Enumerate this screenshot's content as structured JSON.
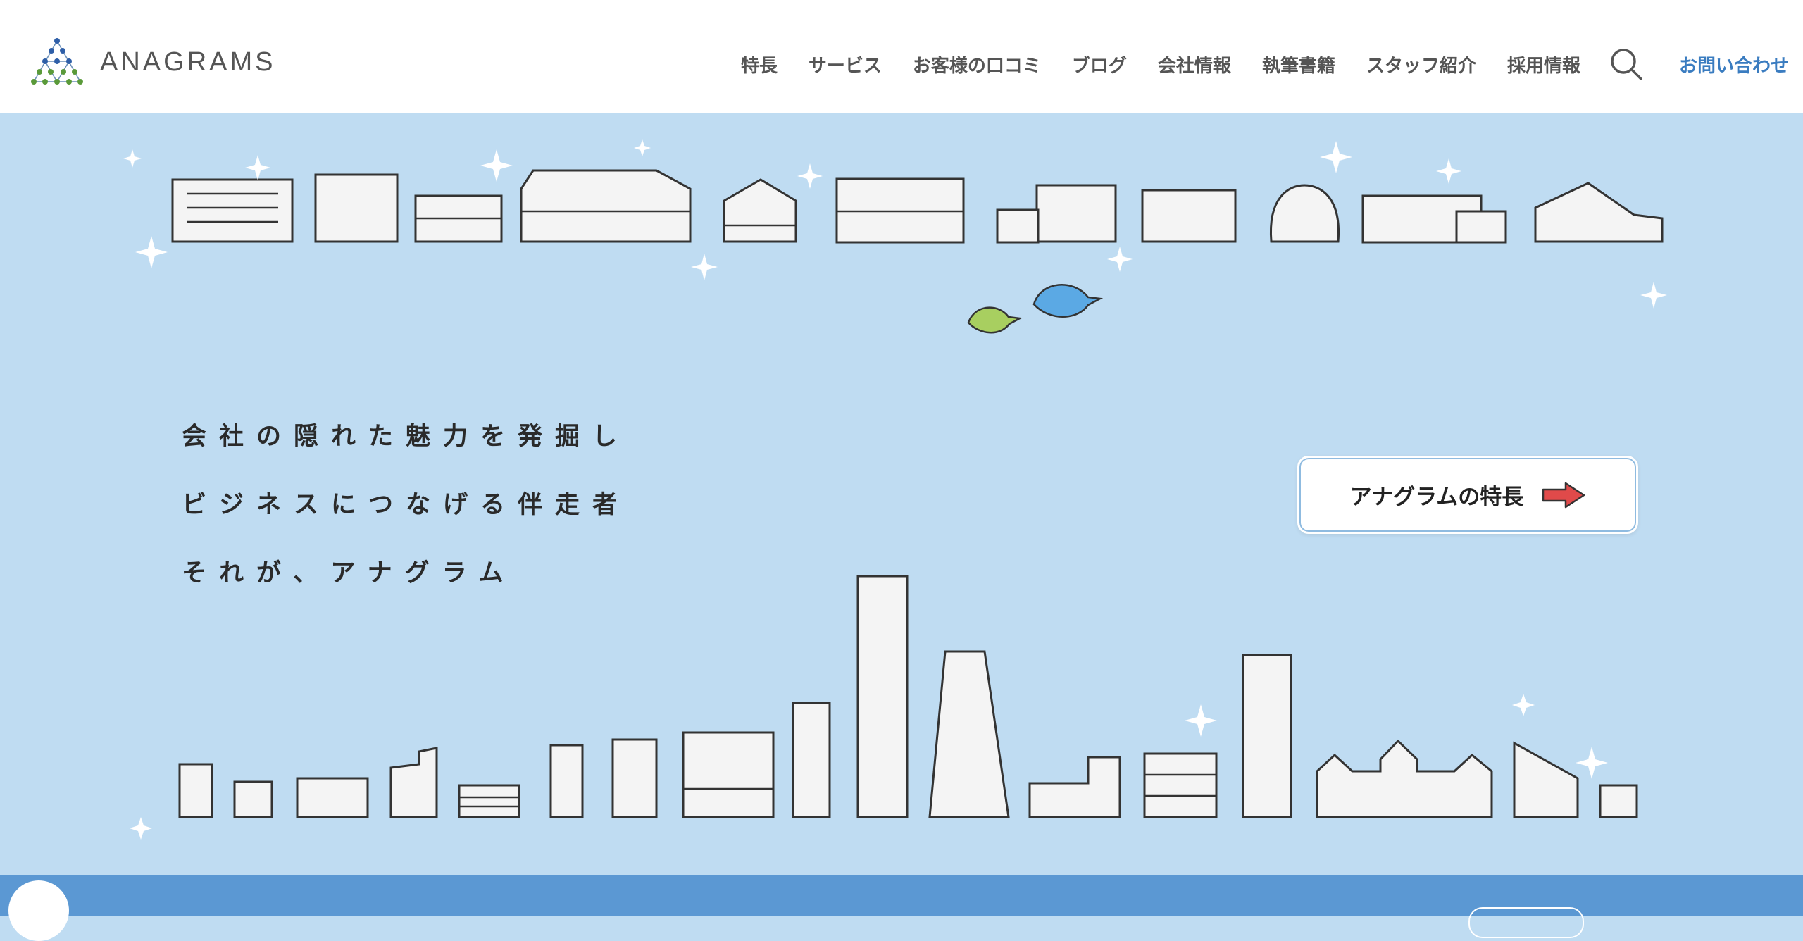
{
  "header": {
    "logo_text": "ANAGRAMS",
    "nav": [
      {
        "label": "特長"
      },
      {
        "label": "サービス"
      },
      {
        "label": "お客様の口コミ"
      },
      {
        "label": "ブログ"
      },
      {
        "label": "会社情報"
      },
      {
        "label": "執筆書籍"
      },
      {
        "label": "スタッフ紹介"
      },
      {
        "label": "採用情報"
      }
    ],
    "search_icon": "search-icon",
    "contact_label": "お問い合わせ"
  },
  "hero": {
    "tagline": [
      "会社の隠れた魅力を発掘し",
      "ビジネスにつなげる伴走者",
      "それが、アナグラム"
    ],
    "feature_button_label": "アナグラムの特長",
    "arrow_icon": "right-arrow-icon"
  },
  "colors": {
    "hero_bg": "#bfdcf2",
    "accent_blue": "#3a7cc0",
    "bottom_bar": "#5b98d3",
    "arrow_red": "#e04a4a"
  }
}
